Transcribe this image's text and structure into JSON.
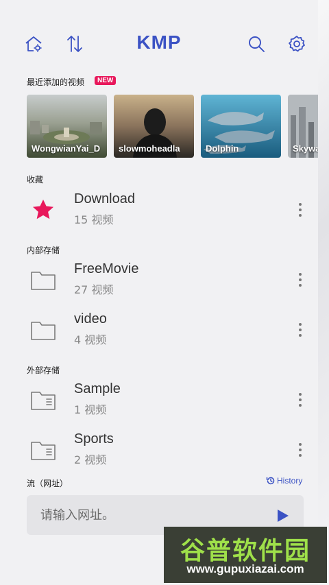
{
  "app": {
    "logo": "KMP"
  },
  "topbar": {
    "home_icon": "home-settings-icon",
    "sort_icon": "sort-icon",
    "search_icon": "search-icon",
    "settings_icon": "gear-icon"
  },
  "recent": {
    "title": "最近添加的视频",
    "badge": "NEW",
    "items": [
      {
        "label": "WongwianYai_D"
      },
      {
        "label": "slowmoheadla"
      },
      {
        "label": "Dolphin"
      },
      {
        "label": "Skyway"
      }
    ]
  },
  "favorites": {
    "title": "收藏",
    "items": [
      {
        "name": "Download",
        "count": "15 视频"
      }
    ]
  },
  "internal": {
    "title": "内部存储",
    "items": [
      {
        "name": "FreeMovie",
        "count": "27 视频"
      },
      {
        "name": "video",
        "count": "4 视频"
      }
    ]
  },
  "external": {
    "title": "外部存储",
    "items": [
      {
        "name": "Sample",
        "count": "1 视频"
      },
      {
        "name": "Sports",
        "count": "2 视频"
      }
    ]
  },
  "stream": {
    "title": "流（网址）",
    "history": "History",
    "placeholder": "请输入网址。"
  },
  "watermark": {
    "chinese": "谷普软件园",
    "url": "www.gupuxiazai.com"
  },
  "colors": {
    "accent": "#3b52c4",
    "badge": "#e8185b",
    "star": "#e8185b"
  }
}
